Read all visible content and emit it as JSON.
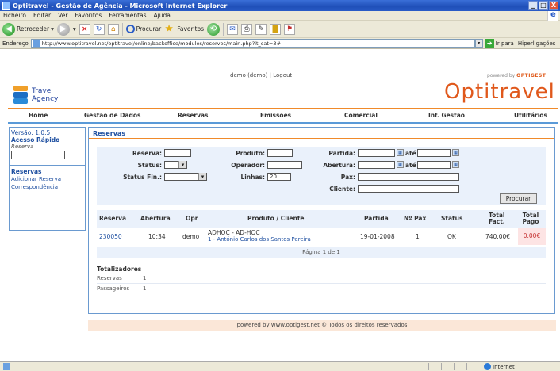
{
  "window": {
    "title": "Optitravel - Gestão de Agência - Microsoft Internet Explorer",
    "controls": [
      "_",
      "□",
      "X"
    ]
  },
  "menubar": [
    "Ficheiro",
    "Editar",
    "Ver",
    "Favoritos",
    "Ferramentas",
    "Ajuda"
  ],
  "toolbar": {
    "back_label": "Retroceder",
    "search_label": "Procurar",
    "favorites_label": "Favoritos"
  },
  "address": {
    "label": "Endereço",
    "url": "http://www.optitravel.net/optitravel/online/backoffice/modules/reserves/main.php?it_cat=3#",
    "go_label": "Ir para",
    "links_label": "Hiperligações"
  },
  "header": {
    "logo_line1": "Travel",
    "logo_line2": "Agency",
    "user": "demo (demo) | Logout",
    "powered_prefix": "powered by",
    "powered_brand": "OPTIGEST",
    "brand": "Optitravel"
  },
  "nav": [
    "Home",
    "Gestão de Dados",
    "Reservas",
    "Emissões",
    "Comercial",
    "Inf. Gestão",
    "Utilitários"
  ],
  "sidebar": {
    "version": "Versão: 1.0.5",
    "quick_title": "Acesso Rápido",
    "quick_label": "Reserva",
    "section_title": "Reservas",
    "links": [
      "Adicionar Reserva",
      "Correspondência"
    ]
  },
  "main": {
    "title": "Reservas",
    "form": {
      "reserva": "Reserva:",
      "status": "Status:",
      "status_fin": "Status Fin.:",
      "produto": "Produto:",
      "operador": "Operador:",
      "linhas": "Linhas:",
      "linhas_value": "20",
      "partida": "Partida:",
      "abertura": "Abertura:",
      "ate": "até",
      "pax": "Pax:",
      "cliente": "Cliente:",
      "search_button": "Procurar"
    },
    "table": {
      "headers": {
        "reserva": "Reserva",
        "abertura": "Abertura",
        "opr": "Opr",
        "produto": "Produto / Cliente",
        "partida": "Partida",
        "npax": "Nº Pax",
        "status": "Status",
        "total_fact_1": "Total",
        "total_fact_2": "Fact.",
        "total_pago_1": "Total",
        "total_pago_2": "Pago"
      },
      "rows": [
        {
          "reserva": "230050",
          "abertura": "10:34",
          "opr": "demo",
          "produto": "ADHOC - AD-HOC",
          "cliente": "1 - António Carlos dos Santos Pereira",
          "partida": "19-01-2008",
          "npax": "1",
          "status": "OK",
          "total_fact": "740.00€",
          "total_pago": "0.00€"
        }
      ],
      "pager": "Página 1 de 1"
    },
    "totals": {
      "title": "Totalizadores",
      "reservas_label": "Reservas",
      "reservas_value": "1",
      "passageiros_label": "Passageiros",
      "passageiros_value": "1"
    }
  },
  "footer": "powered by www.optigest.net © Todos os direitos reservados",
  "statusbar": {
    "zone": "Internet"
  }
}
